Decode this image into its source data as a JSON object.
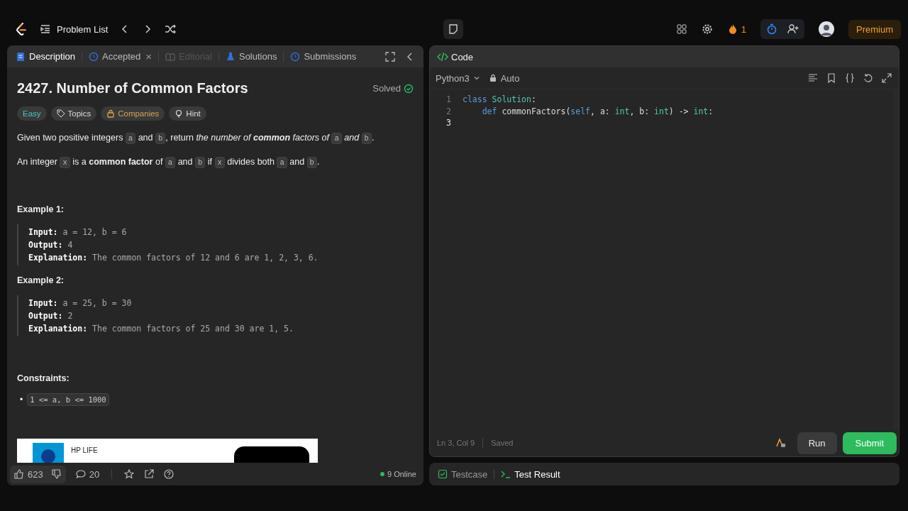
{
  "header": {
    "problem_list": "Problem List",
    "streak": "1",
    "premium": "Premium"
  },
  "left_tabs": [
    {
      "label": "Description",
      "selected": true,
      "disabled": false,
      "kind": "doc"
    },
    {
      "label": "Accepted",
      "selected": false,
      "disabled": false,
      "kind": "clock",
      "close": "×"
    },
    {
      "label": "Editorial",
      "selected": false,
      "disabled": true,
      "kind": "book"
    },
    {
      "label": "Solutions",
      "selected": false,
      "disabled": false,
      "kind": "flask"
    },
    {
      "label": "Submissions",
      "selected": false,
      "disabled": false,
      "kind": "clock"
    }
  ],
  "problem": {
    "title": "2427. Number of Common Factors",
    "status": "Solved",
    "tags": [
      {
        "label": "Easy",
        "kind": "difficulty"
      },
      {
        "label": "Topics",
        "kind": "tag"
      },
      {
        "label": "Companies",
        "kind": "lock"
      },
      {
        "label": "Hint",
        "kind": "bulb"
      }
    ],
    "paragraphs": [
      [
        {
          "t": "Given two positive integers ",
          "kind": "text"
        },
        {
          "t": "a",
          "kind": "code"
        },
        {
          "t": " and ",
          "kind": "text"
        },
        {
          "t": "b",
          "kind": "code"
        },
        {
          "t": ", return ",
          "kind": "text"
        },
        {
          "t": "the number of ",
          "kind": "italic"
        },
        {
          "t": "common",
          "kind": "bolditalic"
        },
        {
          "t": " factors of ",
          "kind": "italic"
        },
        {
          "t": "a",
          "kind": "code"
        },
        {
          "t": " and ",
          "kind": "italic"
        },
        {
          "t": "b",
          "kind": "code"
        },
        {
          "t": ".",
          "kind": "text"
        }
      ],
      [
        {
          "t": "An integer ",
          "kind": "text"
        },
        {
          "t": "x",
          "kind": "code"
        },
        {
          "t": " is a ",
          "kind": "text"
        },
        {
          "t": "common factor",
          "kind": "bold"
        },
        {
          "t": " of ",
          "kind": "text"
        },
        {
          "t": "a",
          "kind": "code"
        },
        {
          "t": " and ",
          "kind": "text"
        },
        {
          "t": "b",
          "kind": "code"
        },
        {
          "t": " if ",
          "kind": "text"
        },
        {
          "t": "x",
          "kind": "code"
        },
        {
          "t": " divides both ",
          "kind": "text"
        },
        {
          "t": "a",
          "kind": "code"
        },
        {
          "t": " and ",
          "kind": "text"
        },
        {
          "t": "b",
          "kind": "code"
        },
        {
          "t": ".",
          "kind": "text"
        }
      ]
    ],
    "examples": [
      {
        "heading": "Example 1:",
        "lines": [
          {
            "label": "Input:",
            "value": "a = 12, b = 6"
          },
          {
            "label": "Output:",
            "value": "4"
          },
          {
            "label": "Explanation:",
            "value": "The common factors of 12 and 6 are 1, 2, 3, 6."
          }
        ]
      },
      {
        "heading": "Example 2:",
        "lines": [
          {
            "label": "Input:",
            "value": "a = 25, b = 30"
          },
          {
            "label": "Output:",
            "value": "2"
          },
          {
            "label": "Explanation:",
            "value": "The common factors of 25 and 30 are 1, 5."
          }
        ]
      }
    ],
    "constraints_heading": "Constraints:",
    "constraints": [
      {
        "bullet": "•",
        "text": "1 <= a, b <= 1000"
      }
    ],
    "ad": {
      "label": "HP LIFE"
    }
  },
  "footer": {
    "likes": "623",
    "comments": "20",
    "online": "9 Online"
  },
  "code_panel": {
    "title": "Code",
    "language": "Python3",
    "mode": "Auto",
    "lines": [
      {
        "number": "1",
        "tokens": [
          {
            "t": "class ",
            "kind": "keyword"
          },
          {
            "t": "Solution",
            "kind": "class"
          },
          {
            "t": ":",
            "kind": "plain"
          }
        ]
      },
      {
        "number": "2",
        "tokens": [
          {
            "t": "    def ",
            "kind": "keyword"
          },
          {
            "t": "commonFactors(",
            "kind": "plain"
          },
          {
            "t": "self",
            "kind": "keyword"
          },
          {
            "t": ", a: ",
            "kind": "plain"
          },
          {
            "t": "int",
            "kind": "class"
          },
          {
            "t": ", b: ",
            "kind": "plain"
          },
          {
            "t": "int",
            "kind": "class"
          },
          {
            "t": ") -> ",
            "kind": "plain"
          },
          {
            "t": "int",
            "kind": "class"
          },
          {
            "t": ":",
            "kind": "plain"
          }
        ]
      },
      {
        "number": "3"
      }
    ],
    "cursor": "Ln 3, Col 9",
    "save_state": "Saved",
    "run": "Run",
    "submit": "Submit"
  },
  "bottom_tabs": [
    {
      "label": "Testcase",
      "selected": false,
      "kind": "check"
    },
    {
      "label": "Test Result",
      "selected": true,
      "kind": "terminal"
    }
  ]
}
